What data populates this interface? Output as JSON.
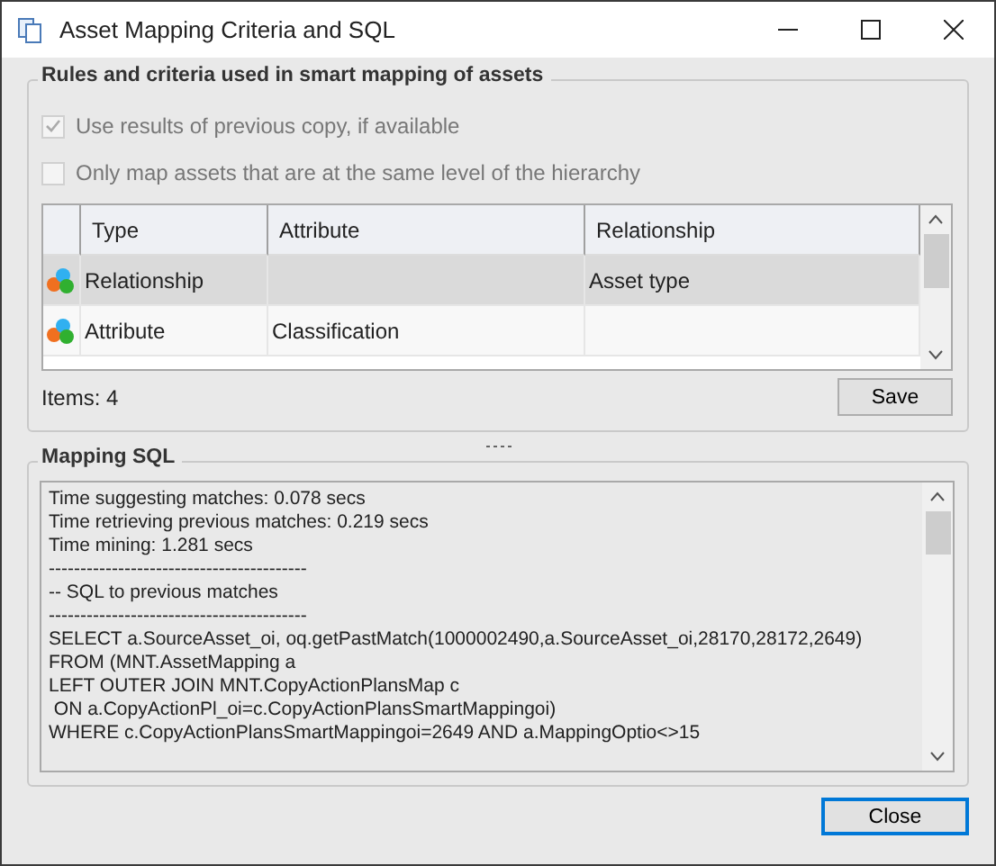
{
  "window": {
    "title": "Asset Mapping Criteria and SQL"
  },
  "rules": {
    "title": "Rules and criteria used in smart mapping of assets",
    "options": [
      {
        "label": "Use results of previous copy, if available",
        "checked": true,
        "disabled": true
      },
      {
        "label": "Only map assets that are at the same level of the hierarchy",
        "checked": false,
        "disabled": true
      }
    ],
    "table": {
      "columns": [
        "Type",
        "Attribute",
        "Relationship"
      ],
      "rows": [
        {
          "type": "Relationship",
          "attribute": "",
          "relationship": "Asset type",
          "selected": true
        },
        {
          "type": "Attribute",
          "attribute": "Classification",
          "relationship": "",
          "selected": false
        }
      ]
    },
    "items": "Items: 4",
    "save": "Save"
  },
  "mapping_sql": {
    "title": "Mapping SQL",
    "lines": [
      "Time suggesting matches: 0.078 secs",
      "Time retrieving previous matches: 0.219 secs",
      "Time mining: 1.281 secs",
      "-----------------------------------------",
      "-- SQL to previous matches",
      "-----------------------------------------",
      "SELECT a.SourceAsset_oi, oq.getPastMatch(1000002490,a.SourceAsset_oi,28170,28172,2649)",
      "FROM (MNT.AssetMapping a",
      "LEFT OUTER JOIN MNT.CopyActionPlansMap c",
      " ON a.CopyActionPl_oi=c.CopyActionPlansSmartMappingoi)",
      "WHERE c.CopyActionPlansSmartMappingoi=2649 AND a.MappingOptio<>15"
    ]
  },
  "buttons": [
    "Close"
  ]
}
